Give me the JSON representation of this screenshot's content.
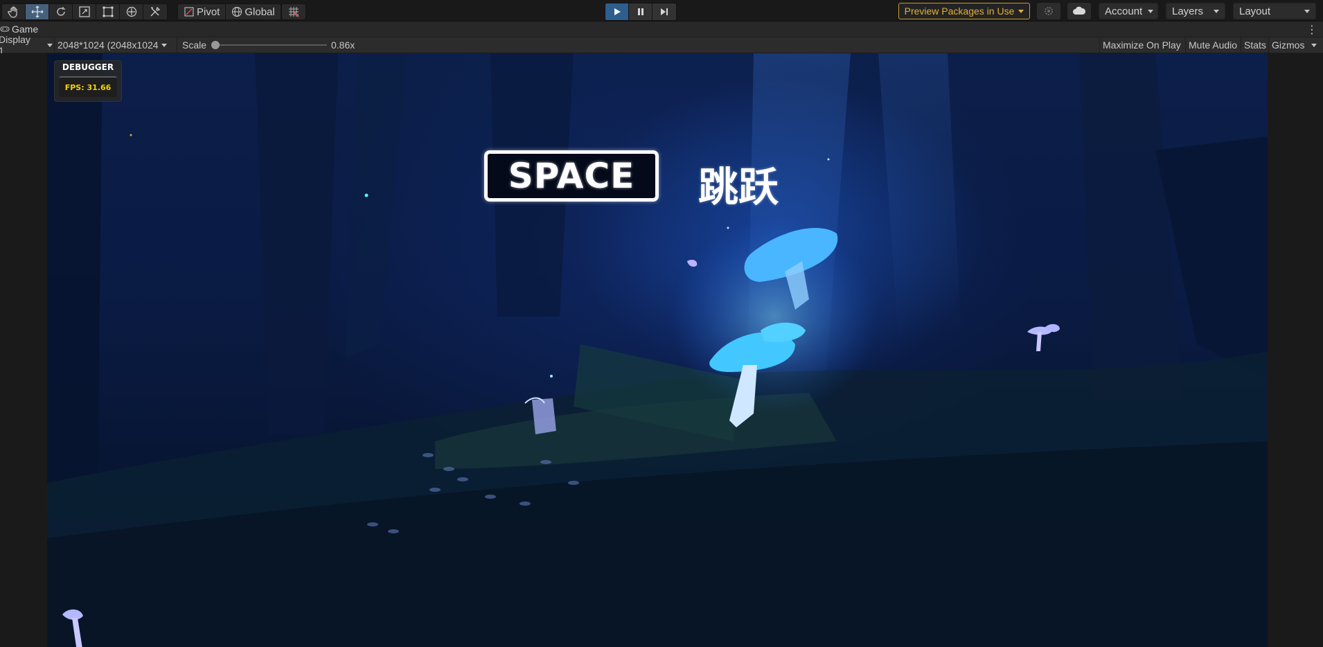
{
  "toolbar": {
    "tools": [
      {
        "name": "hand-tool",
        "icon": "hand-icon"
      },
      {
        "name": "move-tool",
        "icon": "move-icon",
        "active": true
      },
      {
        "name": "rotate-tool",
        "icon": "rotate-icon"
      },
      {
        "name": "scale-tool",
        "icon": "scale-icon"
      },
      {
        "name": "rect-tool",
        "icon": "rect-icon"
      },
      {
        "name": "transform-tool",
        "icon": "transform-icon"
      },
      {
        "name": "custom-tool",
        "icon": "tools-icon"
      }
    ],
    "pivot_label": "Pivot",
    "global_label": "Global",
    "grid_snap_icon": "grid-snap-icon",
    "preview_packages_label": "Preview Packages in Use",
    "account_label": "Account",
    "layers_label": "Layers",
    "layout_label": "Layout"
  },
  "playback": {
    "play_active": true
  },
  "tab": {
    "label": "Game",
    "icon": "gamepad-icon"
  },
  "game_bar": {
    "display": "Display 1",
    "resolution": "2048*1024 (2048x1024",
    "scale_label": "Scale",
    "scale_value": "0.86x",
    "scale_fraction": 0.0,
    "maximize_label": "Maximize On Play",
    "mute_label": "Mute Audio",
    "stats_label": "Stats",
    "gizmos_label": "Gizmos"
  },
  "game_view": {
    "debugger_title": "DEBUGGER",
    "fps_text": "FPS: 31.66",
    "key_prompt": "SPACE",
    "action_label": "跳跃"
  },
  "colors": {
    "accent_play": "#2e5e8e",
    "preview_packages": "#e2b13c",
    "fps_text": "#f5d400"
  }
}
